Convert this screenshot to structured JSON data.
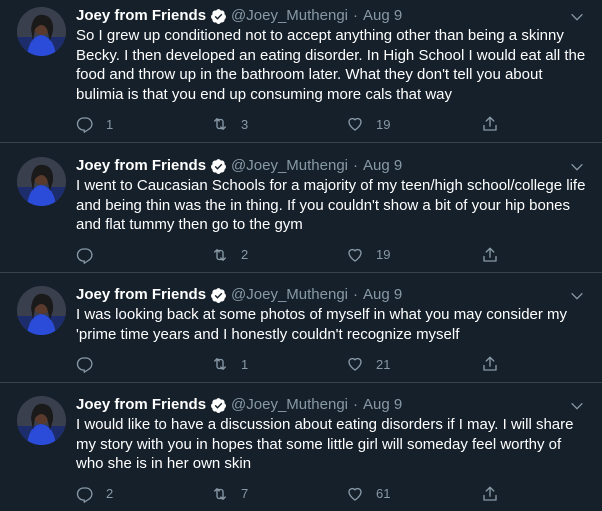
{
  "tweets": [
    {
      "name": "Joey from Friends",
      "handle": "@Joey_Muthengi",
      "separator": "·",
      "date": "Aug 9",
      "text": "So I grew up conditioned not to accept anything other than being a skinny Becky. I then developed an eating disorder. In High School I would eat all the food and throw up in the bathroom later. What they don't tell you about bulimia is that you end up consuming more cals that way",
      "replies": "1",
      "retweets": "3",
      "likes": "19"
    },
    {
      "name": "Joey from Friends",
      "handle": "@Joey_Muthengi",
      "separator": "·",
      "date": "Aug 9",
      "text": "I went to Caucasian Schools for a majority of my teen/high school/college life and being thin was the in thing. If you couldn't show a bit of your hip bones and flat tummy then go to the gym",
      "replies": "",
      "retweets": "2",
      "likes": "19"
    },
    {
      "name": "Joey from Friends",
      "handle": "@Joey_Muthengi",
      "separator": "·",
      "date": "Aug 9",
      "text": "I was looking back at some photos of myself in what you may consider my 'prime time years and I honestly couldn't recognize myself",
      "replies": "",
      "retweets": "1",
      "likes": "21"
    },
    {
      "name": "Joey from Friends",
      "handle": "@Joey_Muthengi",
      "separator": "·",
      "date": "Aug 9",
      "text": "I would like to have a discussion about eating disorders if I may. I will share my story with you in hopes that some little girl will someday feel worthy of who she is in her own skin",
      "replies": "2",
      "retweets": "7",
      "likes": "61"
    }
  ],
  "icons": {
    "verified": "verified-badge-icon",
    "caret": "chevron-down-icon",
    "reply": "reply-icon",
    "retweet": "retweet-icon",
    "like": "heart-icon",
    "share": "share-icon"
  },
  "colors": {
    "background": "#15202b",
    "divider": "#38444d",
    "secondary_text": "#8899a6",
    "primary_text": "#ffffff"
  }
}
